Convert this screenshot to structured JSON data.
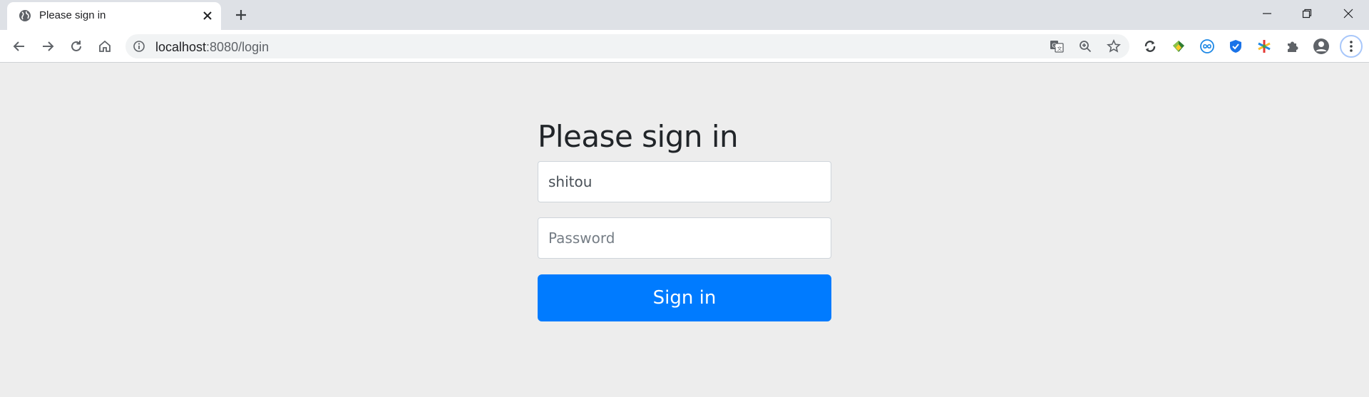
{
  "tab": {
    "title": "Please sign in",
    "favicon": "globe-icon"
  },
  "window_controls": [
    "minimize-icon",
    "restore-icon",
    "close-icon"
  ],
  "toolbar": {
    "back": "back-arrow-icon",
    "forward": "forward-arrow-icon",
    "reload": "reload-icon",
    "home": "home-icon",
    "url_host": "localhost",
    "url_path": ":8080/login",
    "omnibox_icons": [
      "translate-icon",
      "zoom-icon",
      "bookmark-star-icon"
    ],
    "extensions": [
      "sync-extension-icon",
      "gem-extension-icon",
      "infinity-extension-icon",
      "shield-extension-icon",
      "colorful-star-extension-icon",
      "puzzle-extensions-icon",
      "profile-avatar-icon",
      "menu-kebab-icon"
    ]
  },
  "form": {
    "heading": "Please sign in",
    "username_value": "shitou",
    "password_placeholder": "Password",
    "submit_label": "Sign in"
  },
  "colors": {
    "primary_button": "#007bff",
    "page_background": "#ededed",
    "tabstrip_background": "#dee1e6"
  }
}
